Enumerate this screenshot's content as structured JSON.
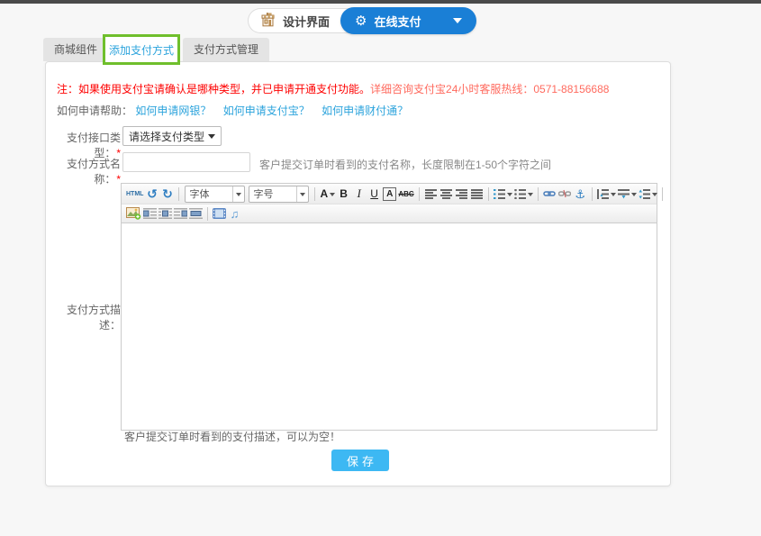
{
  "header": {
    "design_label": "设计界面",
    "online_pay_label": "在线支付"
  },
  "tabs": {
    "mall_components": "商城组件",
    "add_payment": "添加支付方式",
    "manage_payment": "支付方式管理"
  },
  "notice": {
    "prefix": "注：如果使用支付宝请确认是哪种类型，并已申请开通支付功能。",
    "hotline": "详细咨询支付宝24小时客服热线：0571-88156688"
  },
  "help": {
    "label": "如何申请帮助：",
    "link_bank": "如何申请网银？",
    "link_alipay": "如何申请支付宝？",
    "link_tenpay": "如何申请财付通？"
  },
  "form": {
    "required_mark": "*",
    "interface_type_label": "支付接口类型：",
    "interface_type_value": "请选择支付类型",
    "name_label": "支付方式名称：",
    "name_value": "",
    "name_hint": "客户提交订单时看到的支付名称，长度限制在1-50个字符之间",
    "desc_label": "支付方式描述：",
    "desc_hint": "客户提交订单时看到的支付描述，可以为空！"
  },
  "editor": {
    "html_label": "HTML",
    "undo_glyph": "↺",
    "redo_glyph": "↻",
    "font_family_value": "字体",
    "font_size_value": "字号",
    "forecolor_label": "A",
    "bold_label": "B",
    "italic_label": "I",
    "underline_label": "U",
    "backcolor_label": "A",
    "strike_label": "ABC",
    "anchor_glyph": "⚓",
    "music_glyph": "♫",
    "content": ""
  },
  "save_button_label": "保存",
  "colors": {
    "accent_blue": "#1a7fd6",
    "link_blue": "#2ba3dc",
    "save_blue": "#3db8f3",
    "highlight_green": "#6fbf2c",
    "notice_red": "#fe0000",
    "hotline_red": "#ff6a5e",
    "topbar_gray": "#4a4a4a"
  }
}
